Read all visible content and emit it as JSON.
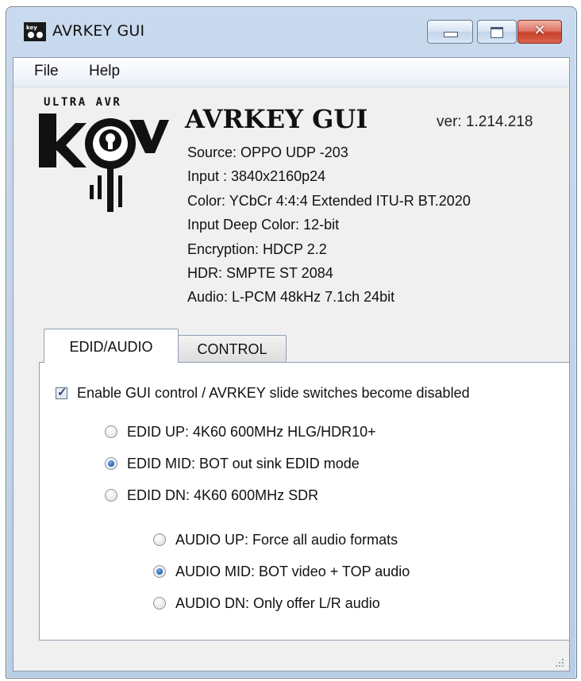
{
  "window": {
    "title": "AVRKEY GUI"
  },
  "menu": {
    "file": "File",
    "help": "Help"
  },
  "logo": {
    "top_text": "ULTRA AVR"
  },
  "header": {
    "app_title": "AVRKEY GUI",
    "version": "ver: 1.214.218"
  },
  "info": {
    "source": "Source: OPPO UDP -203",
    "input": "Input : 3840x2160p24",
    "color": "Color: YCbCr 4:4:4 Extended ITU-R BT.2020",
    "deep_color": "Input Deep Color: 12-bit",
    "encryption": "Encryption: HDCP 2.2",
    "hdr": "HDR:  SMPTE ST 2084",
    "audio": "Audio: L-PCM 48kHz 7.1ch 24bit"
  },
  "tabs": {
    "edid_audio": "EDID/AUDIO",
    "control": "CONTROL",
    "active": "EDID/AUDIO"
  },
  "panel": {
    "enable_label": "Enable GUI control / AVRKEY slide switches become disabled",
    "enable_checked": true,
    "edid_options": [
      {
        "label": "EDID UP: 4K60 600MHz HLG/HDR10+",
        "selected": false
      },
      {
        "label": "EDID MID: BOT out sink EDID mode",
        "selected": true
      },
      {
        "label": "EDID DN: 4K60 600MHz SDR",
        "selected": false
      }
    ],
    "audio_options": [
      {
        "label": "AUDIO UP: Force all audio formats",
        "selected": false
      },
      {
        "label": "AUDIO MID: BOT video + TOP audio",
        "selected": true
      },
      {
        "label": "AUDIO DN:  Only offer L/R audio",
        "selected": false
      }
    ]
  }
}
